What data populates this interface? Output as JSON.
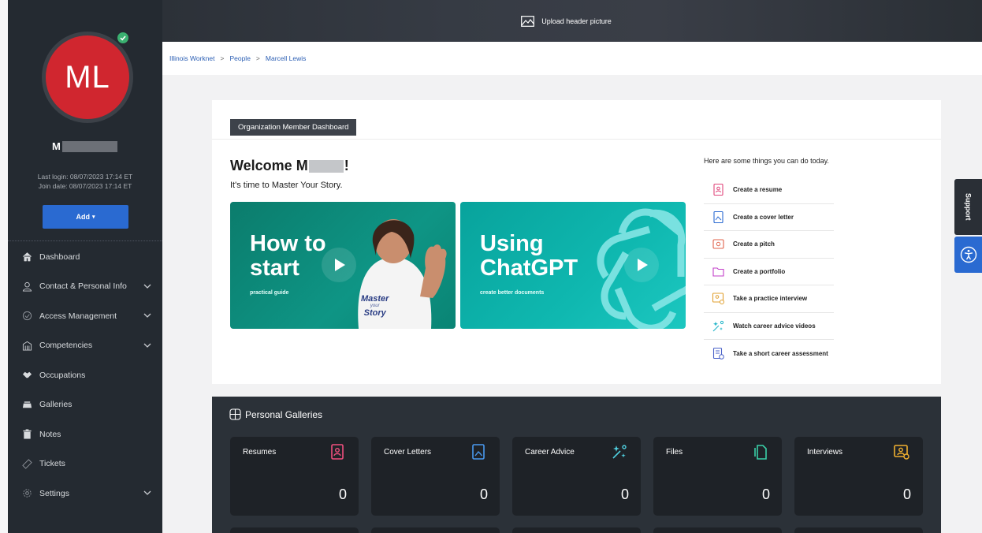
{
  "header": {
    "upload_label": "Upload header picture"
  },
  "sidebar": {
    "avatar_initials": "ML",
    "user_name_visible": "M",
    "last_login": "Last login: 08/07/2023 17:14 ET",
    "join_date": "Join date: 08/07/2023 17:14 ET",
    "add_button": "Add",
    "items": [
      {
        "label": "Dashboard",
        "icon": "home-icon",
        "has_chevron": false
      },
      {
        "label": "Contact & Personal Info",
        "icon": "person-icon",
        "has_chevron": true
      },
      {
        "label": "Access Management",
        "icon": "access-icon",
        "has_chevron": true
      },
      {
        "label": "Competencies",
        "icon": "building-icon",
        "has_chevron": true
      },
      {
        "label": "Occupations",
        "icon": "handshake-icon",
        "has_chevron": false
      },
      {
        "label": "Galleries",
        "icon": "layers-icon",
        "has_chevron": false
      },
      {
        "label": "Notes",
        "icon": "trash-note-icon",
        "has_chevron": false
      },
      {
        "label": "Tickets",
        "icon": "ticket-icon",
        "has_chevron": false
      },
      {
        "label": "Settings",
        "icon": "gear-icon",
        "has_chevron": true
      }
    ]
  },
  "breadcrumb": [
    "Illinois Worknet",
    "People",
    "Marcell Lewis"
  ],
  "dashboard": {
    "label": "Organization Member Dashboard",
    "welcome_prefix": "Welcome M",
    "welcome_suffix": "!",
    "subtitle": "It's time to Master Your Story.",
    "videos": [
      {
        "title_line1": "How to",
        "title_line2": "start",
        "subtitle": "practical guide",
        "shirt_line1": "Master",
        "shirt_line2": "your",
        "shirt_line3": "Story"
      },
      {
        "title_line1": "Using",
        "title_line2": "ChatGPT",
        "subtitle": "create better documents"
      }
    ],
    "todo_title": "Here are some things you can do today.",
    "todo_items": [
      {
        "label": "Create a resume",
        "icon": "resume-icon",
        "color": "#e0457b"
      },
      {
        "label": "Create a cover letter",
        "icon": "cover-letter-icon",
        "color": "#2a6ad1"
      },
      {
        "label": "Create a pitch",
        "icon": "pitch-icon",
        "color": "#e0624a"
      },
      {
        "label": "Create a portfolio",
        "icon": "portfolio-icon",
        "color": "#c23fc9"
      },
      {
        "label": "Take a practice interview",
        "icon": "interview-icon",
        "color": "#e0a030"
      },
      {
        "label": "Watch career advice videos",
        "icon": "sparkle-icon",
        "color": "#20b4c8"
      },
      {
        "label": "Take a short career assessment",
        "icon": "assessment-icon",
        "color": "#4a62c8"
      }
    ]
  },
  "galleries": {
    "title": "Personal Galleries",
    "tiles": [
      {
        "label": "Resumes",
        "count": "0",
        "icon": "resume-icon",
        "color": "#f0507f"
      },
      {
        "label": "Cover Letters",
        "count": "0",
        "icon": "cover-letter-icon",
        "color": "#4a9af0"
      },
      {
        "label": "Career Advice",
        "count": "0",
        "icon": "sparkle-icon",
        "color": "#50d0e0"
      },
      {
        "label": "Files",
        "count": "0",
        "icon": "files-icon",
        "color": "#3ad0a8"
      },
      {
        "label": "Interviews",
        "count": "0",
        "icon": "interview-icon",
        "color": "#f0b030"
      }
    ]
  },
  "right_tabs": {
    "support": "Support"
  }
}
